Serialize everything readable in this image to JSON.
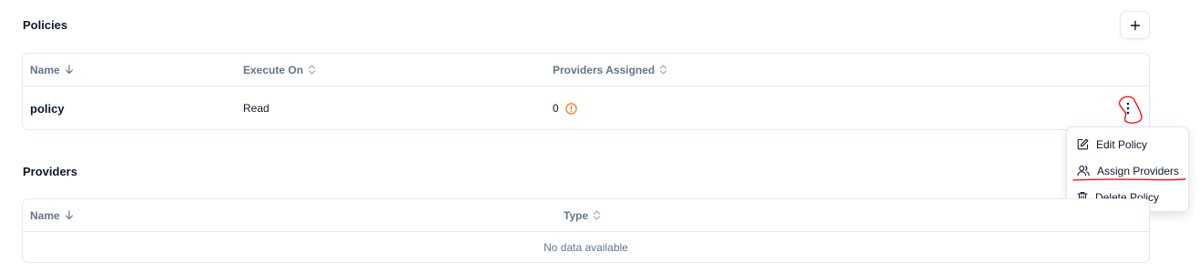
{
  "policies": {
    "title": "Policies",
    "add_button_label": "+",
    "columns": [
      {
        "label": "Name",
        "sort": "desc"
      },
      {
        "label": "Execute On",
        "sort": "none"
      },
      {
        "label": "Providers Assigned",
        "sort": "none"
      }
    ],
    "rows": [
      {
        "name": "policy",
        "execute_on": "Read",
        "providers_assigned": "0",
        "warning_icon": "alert-circle-icon"
      }
    ],
    "row_menu": {
      "items": [
        {
          "label": "Edit Policy",
          "icon": "edit-icon"
        },
        {
          "label": "Assign Providers",
          "icon": "users-icon"
        },
        {
          "label": "Delete Policy",
          "icon": "trash-icon"
        }
      ]
    }
  },
  "providers": {
    "title": "Providers",
    "columns": [
      {
        "label": "Name",
        "sort": "desc"
      },
      {
        "label": "Type",
        "sort": "none"
      }
    ],
    "empty_text": "No data available"
  },
  "colors": {
    "text": "#0f172a",
    "muted": "#64748b",
    "border": "#e2e8f0",
    "warning": "#f97316",
    "annotation": "#ff0000"
  }
}
